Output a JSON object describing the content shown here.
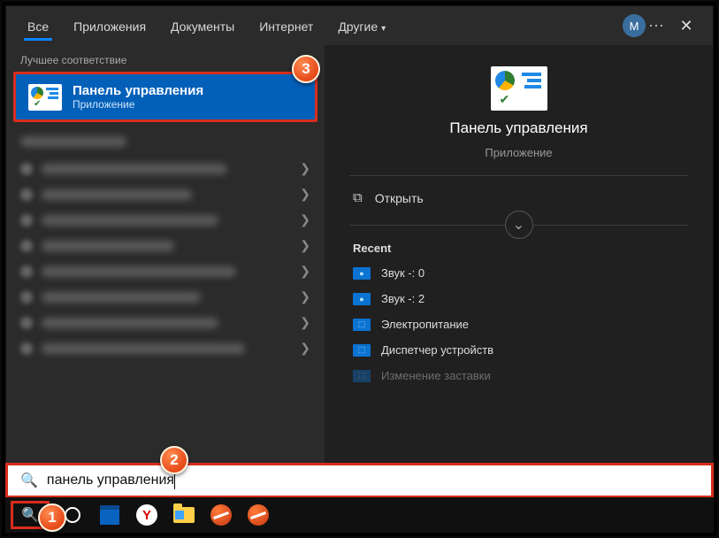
{
  "tabs": {
    "all": "Все",
    "apps": "Приложения",
    "docs": "Документы",
    "web": "Интернет",
    "more": "Другие"
  },
  "avatar_initial": "M",
  "best_match_label": "Лучшее соответствие",
  "best_match": {
    "title": "Панель управления",
    "subtitle": "Приложение"
  },
  "preview": {
    "title": "Панель управления",
    "subtitle": "Приложение",
    "open": "Открыть",
    "recent_label": "Recent",
    "recent": [
      "Звук -: 0",
      "Звук -: 2",
      "Электропитание",
      "Диспетчер устройств",
      "Изменение заставки"
    ]
  },
  "search_value": "панель управления",
  "markers": {
    "m1": "1",
    "m2": "2",
    "m3": "3"
  },
  "taskbar": {
    "yandex": "Y"
  }
}
